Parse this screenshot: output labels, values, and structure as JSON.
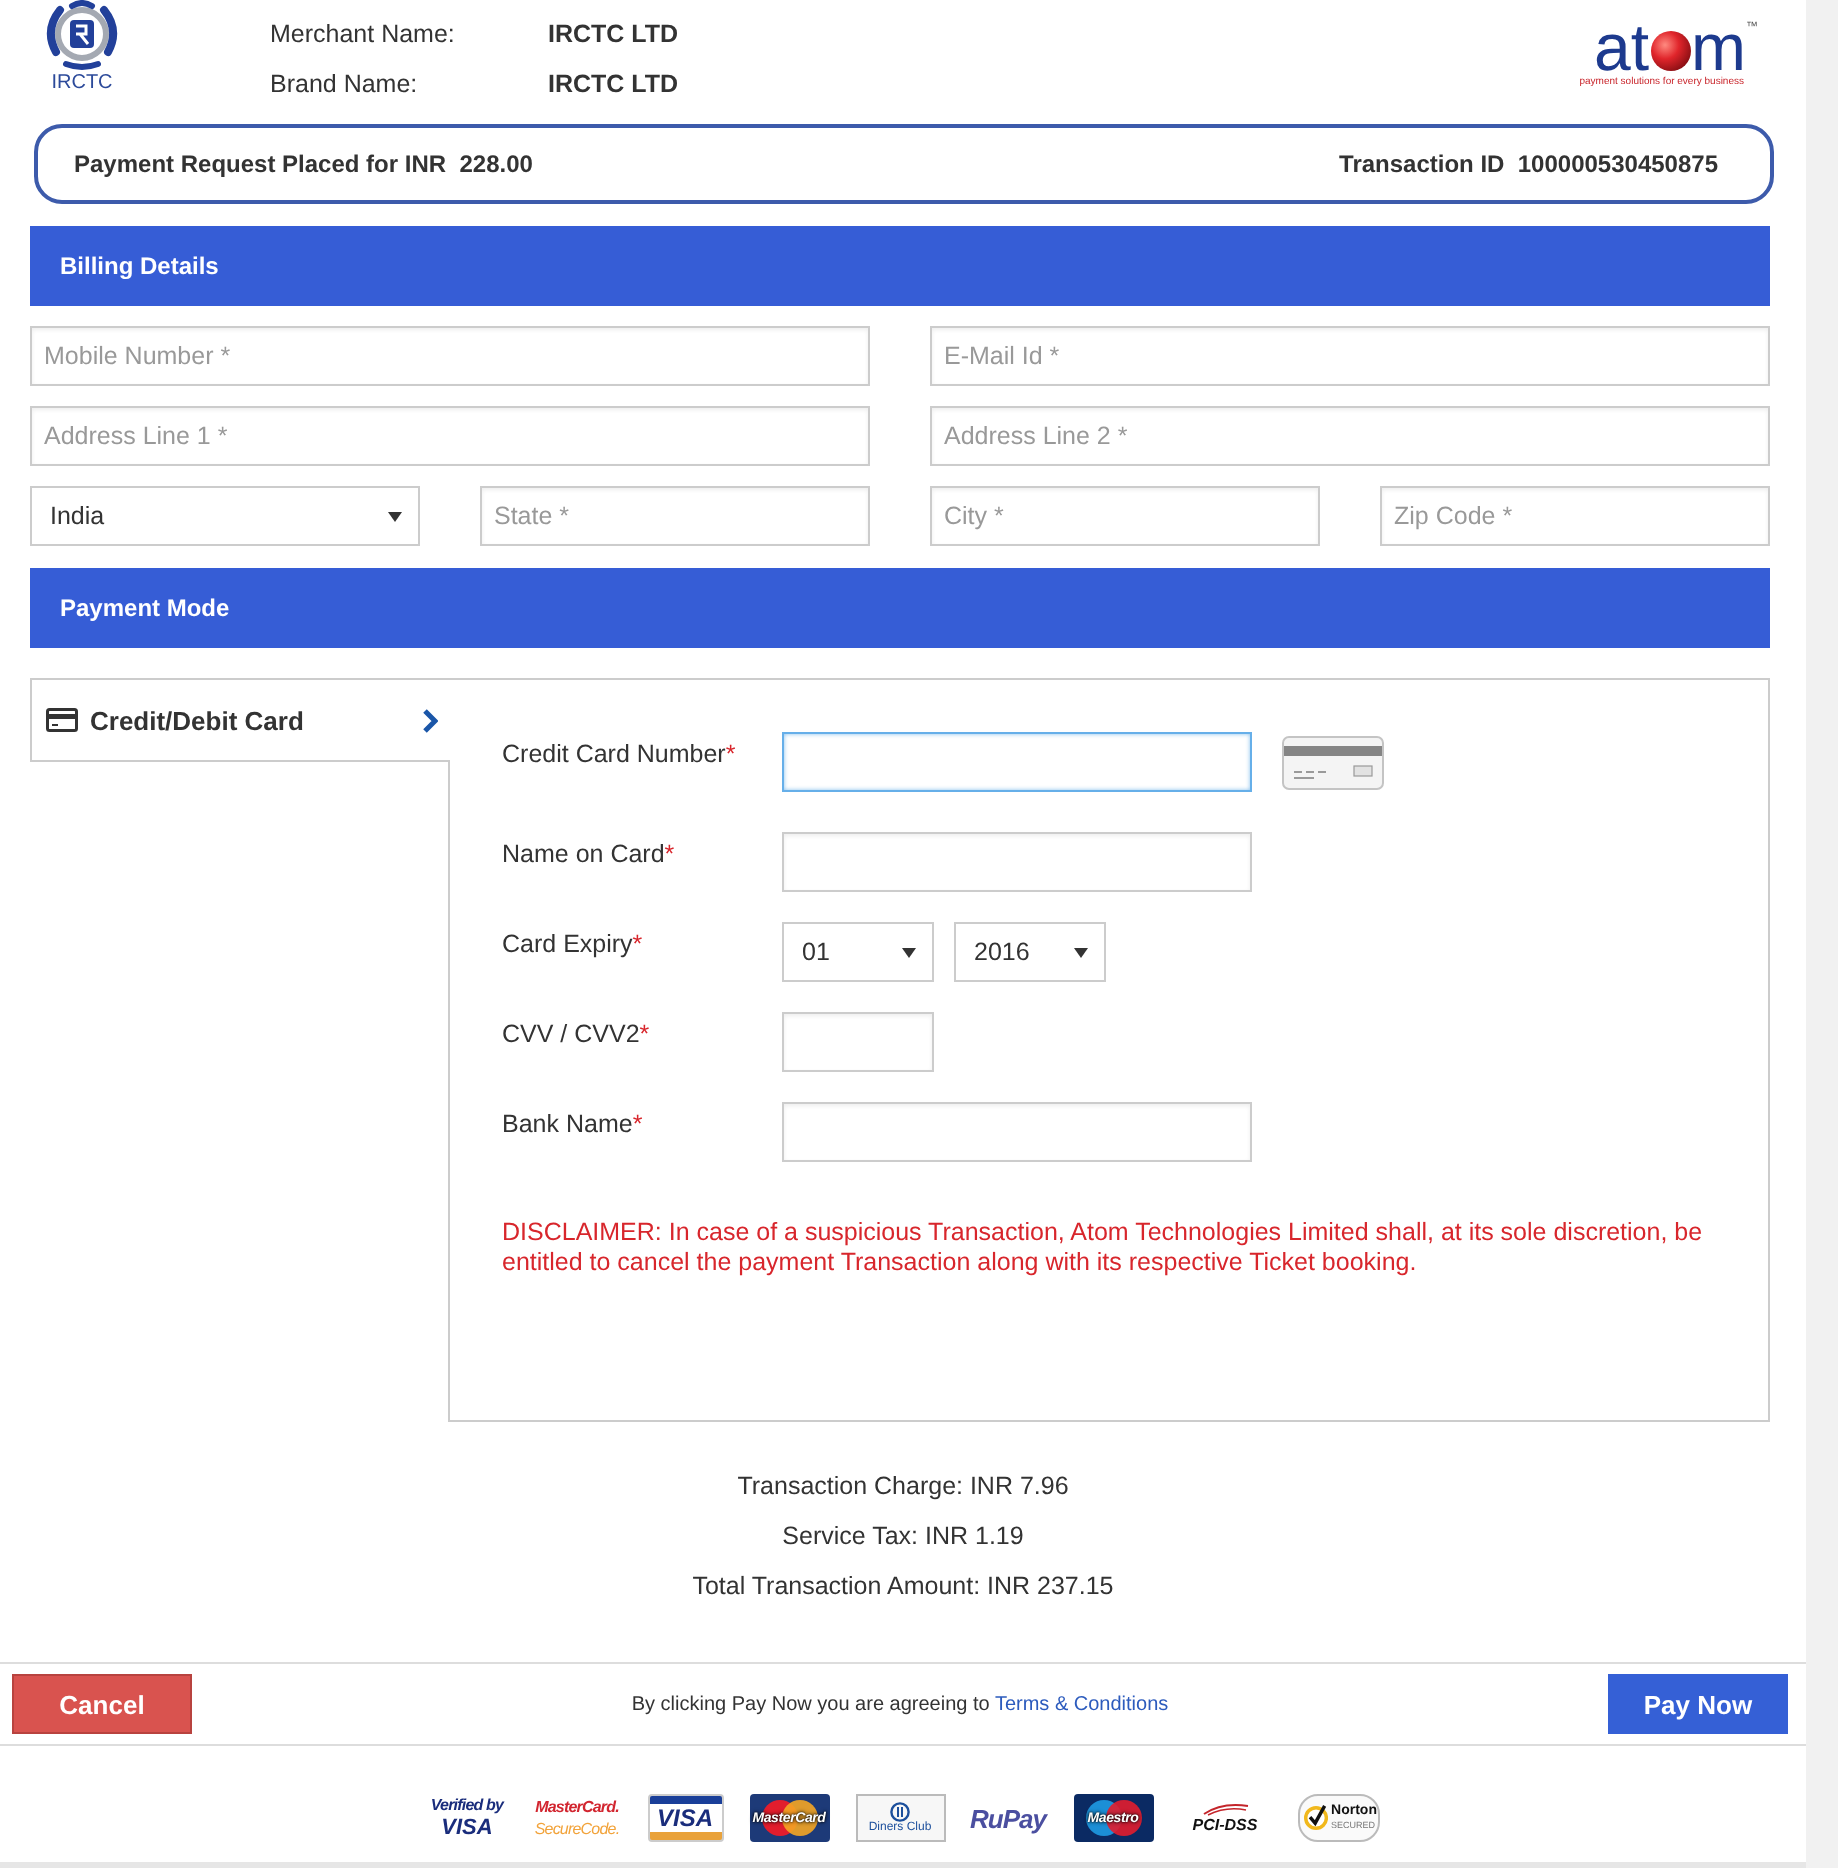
{
  "header": {
    "logo": {
      "caption": "IRCTC"
    },
    "merchant_info": [
      {
        "label": "Merchant Name:",
        "value": "IRCTC LTD"
      },
      {
        "label": "Brand Name:",
        "value": "IRCTC LTD"
      }
    ],
    "provider_logo": {
      "lead": "at",
      "tail": "m",
      "trademark": "™",
      "tagline": "payment solutions for every business"
    }
  },
  "request_bar": {
    "amount": "Payment Request Placed for INR  228.00",
    "transaction": "Transaction ID  100000530450875"
  },
  "billing": {
    "title": "Billing Details",
    "rows": [
      {
        "fields": [
          {
            "kind": "input",
            "placeholder": "Mobile Number *"
          },
          {
            "kind": "input",
            "placeholder": "E-Mail Id *"
          }
        ]
      },
      {
        "fields": [
          {
            "kind": "input",
            "placeholder": "Address Line 1 *"
          },
          {
            "kind": "input",
            "placeholder": "Address Line 2 *"
          }
        ]
      },
      {
        "fields": [
          {
            "kind": "select",
            "value": "India"
          },
          {
            "kind": "input",
            "placeholder": "State *"
          },
          {
            "kind": "input",
            "placeholder": "City *"
          },
          {
            "kind": "input",
            "placeholder": "Zip Code *"
          }
        ]
      }
    ]
  },
  "payment_mode": {
    "title": "Payment Mode",
    "methods": [
      {
        "label": "Credit/Debit Card",
        "selected": true
      }
    ],
    "fields": [
      {
        "kind": "card_number",
        "label": "Credit Card Number",
        "required_mark": "*",
        "focused": true
      },
      {
        "kind": "text",
        "label": "Name on Card",
        "required_mark": "*",
        "focused": false
      },
      {
        "kind": "selects",
        "label": "Card Expiry",
        "required_mark": "*",
        "focused": false,
        "selects": [
          {
            "value": "01"
          },
          {
            "value": "2016"
          }
        ]
      },
      {
        "kind": "short",
        "label": "CVV / CVV2",
        "required_mark": "*",
        "focused": false
      },
      {
        "kind": "text",
        "label": "Bank Name",
        "required_mark": "*",
        "focused": false
      }
    ],
    "disclaimer": "DISCLAIMER: In case of a suspicious Transaction, Atom Technologies Limited shall, at its sole discretion, be entitled to cancel the payment Transaction along with its respective Ticket booking."
  },
  "totals": [
    "Transaction Charge: INR 7.96",
    "Service Tax: INR 1.19",
    "Total Transaction Amount: INR 237.15"
  ],
  "footer": {
    "cancel_button": "Cancel",
    "notice": "By clicking Pay Now you are agreeing to",
    "link": "Terms & Conditions",
    "pay_button": "Pay Now"
  },
  "badges": [
    {
      "kind": "verified_visa",
      "lines": [
        "Verified by",
        "VISA"
      ]
    },
    {
      "kind": "securecode",
      "lines": [
        "MasterCard.",
        "SecureCode."
      ]
    },
    {
      "kind": "visa",
      "lines": [
        "VISA"
      ]
    },
    {
      "kind": "mastercard",
      "lines": [
        "MasterCard"
      ]
    },
    {
      "kind": "diners",
      "lines": [
        "Diners Club"
      ]
    },
    {
      "kind": "rupay",
      "lines": [
        "RuPay"
      ]
    },
    {
      "kind": "maestro",
      "lines": [
        "Maestro"
      ]
    },
    {
      "kind": "pci",
      "lines": [
        "PCI-DSS"
      ]
    },
    {
      "kind": "norton",
      "lines": [
        "Norton",
        "SECURED"
      ]
    }
  ]
}
